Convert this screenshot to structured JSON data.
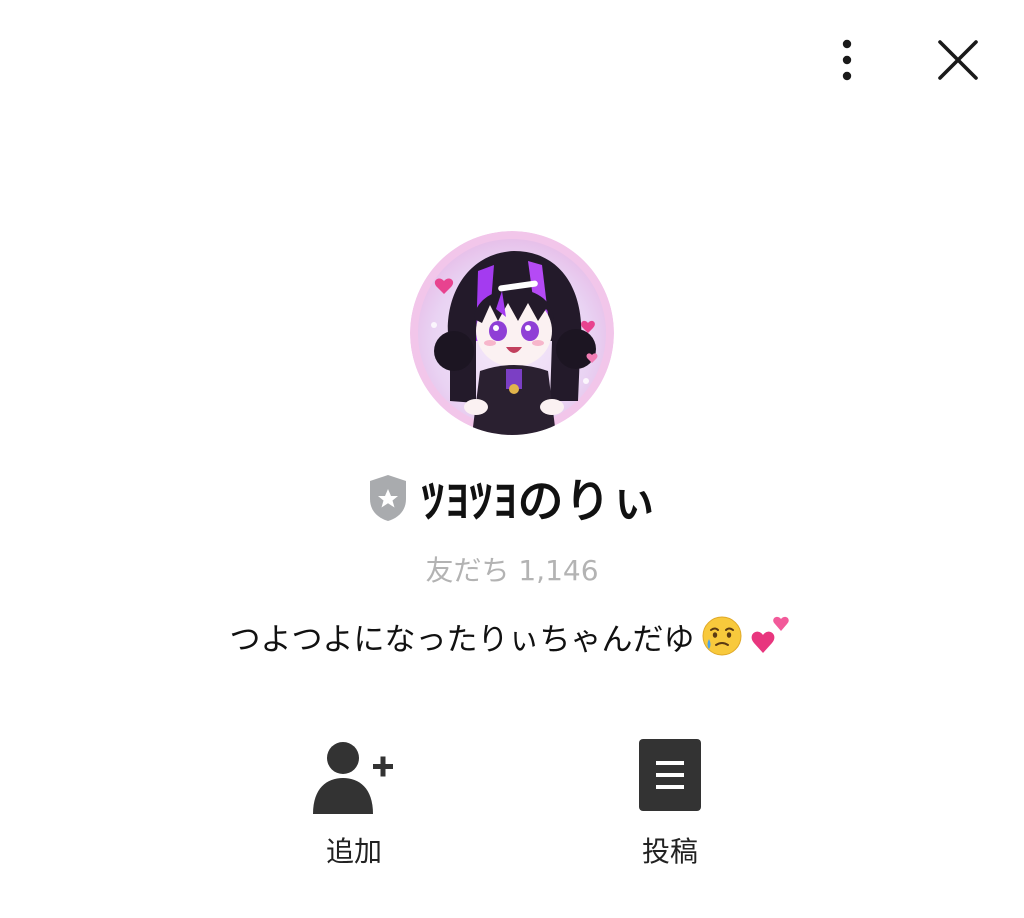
{
  "header": {
    "more_icon": "vertical-ellipsis-icon",
    "close_icon": "close-x-icon"
  },
  "profile": {
    "avatar": "anime-girl-avatar",
    "badge_icon": "shield-star-badge-icon",
    "name": "ﾂﾖﾂﾖのりぃ",
    "friends_label": "友だち 1,146",
    "status_message": "つよつよになったりぃちゃんだゆ",
    "status_emojis": [
      "face-holding-back-tears-emoji",
      "two-hearts-emoji"
    ]
  },
  "actions": {
    "add": {
      "label": "追加",
      "icon": "add-friend-icon"
    },
    "post": {
      "label": "投稿",
      "icon": "post-list-icon"
    }
  },
  "colors": {
    "background": "#ffffff",
    "text": "#111111",
    "muted_text": "#b3b3b3",
    "icon_dark": "#333333",
    "badge_gray": "#a9abae",
    "avatar_accent": "#a43bf0"
  }
}
